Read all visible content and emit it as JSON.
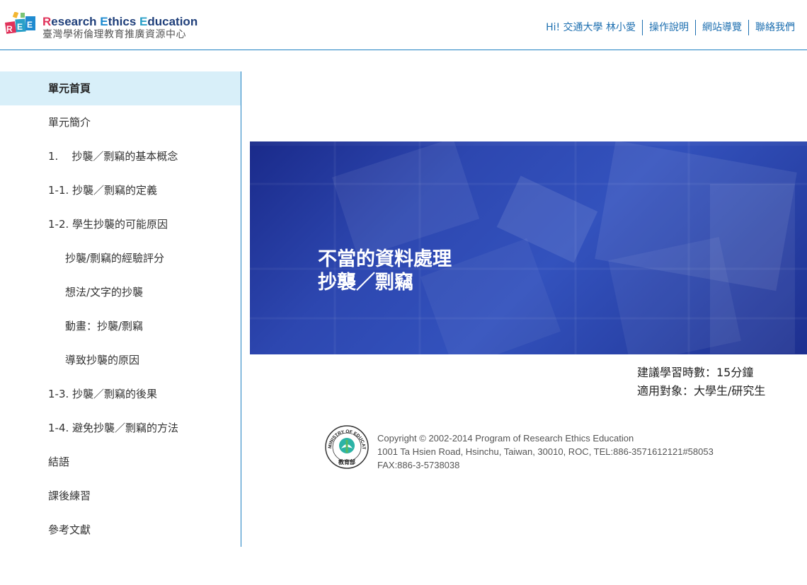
{
  "header": {
    "logo_title_parts": [
      "R",
      "esearch ",
      "E",
      "thics ",
      "E",
      "ducation"
    ],
    "logo_subtitle": "臺灣學術倫理教育推廣資源中心",
    "logo_badge": "REE",
    "nav": {
      "greeting": "Hi! 交通大學 林小愛",
      "guide": "操作說明",
      "sitemap": "網站導覽",
      "contact": "聯絡我們"
    }
  },
  "sidebar": {
    "items": [
      {
        "label": "單元首頁"
      },
      {
        "label": "單元簡介"
      },
      {
        "label": "1.    抄襲／剽竊的基本概念"
      },
      {
        "label": "1-1. 抄襲／剽竊的定義"
      },
      {
        "label": "1-2. 學生抄襲的可能原因"
      },
      {
        "label": "抄襲/剽竊的經驗評分"
      },
      {
        "label": "想法/文字的抄襲"
      },
      {
        "label": "動畫：抄襲/剽竊"
      },
      {
        "label": "導致抄襲的原因"
      },
      {
        "label": "1-3. 抄襲／剽竊的後果"
      },
      {
        "label": "1-4. 避免抄襲／剽竊的方法"
      },
      {
        "label": "結語"
      },
      {
        "label": "課後練習"
      },
      {
        "label": "參考文獻"
      }
    ]
  },
  "banner": {
    "line1": "不當的資料處理",
    "line2": "抄襲／剽竊"
  },
  "info": {
    "duration": "建議學習時數：15分鐘",
    "audience": "適用對象：大學生/研究生"
  },
  "footer": {
    "seal_text": "MINISTRY OF EDUCATION",
    "seal_chinese": "教育部",
    "copyright": "Copyright © 2002-2014 Program of Research Ethics Education",
    "address": "1001 Ta Hsien Road, Hsinchu, Taiwan, 30010, ROC, TEL:886-3571612121#58053",
    "fax": "FAX:886-3-5738038"
  },
  "colors": {
    "accent": "#1d7fc1",
    "active_bg": "#d8eff9",
    "banner_blue": "#2d47b0"
  }
}
